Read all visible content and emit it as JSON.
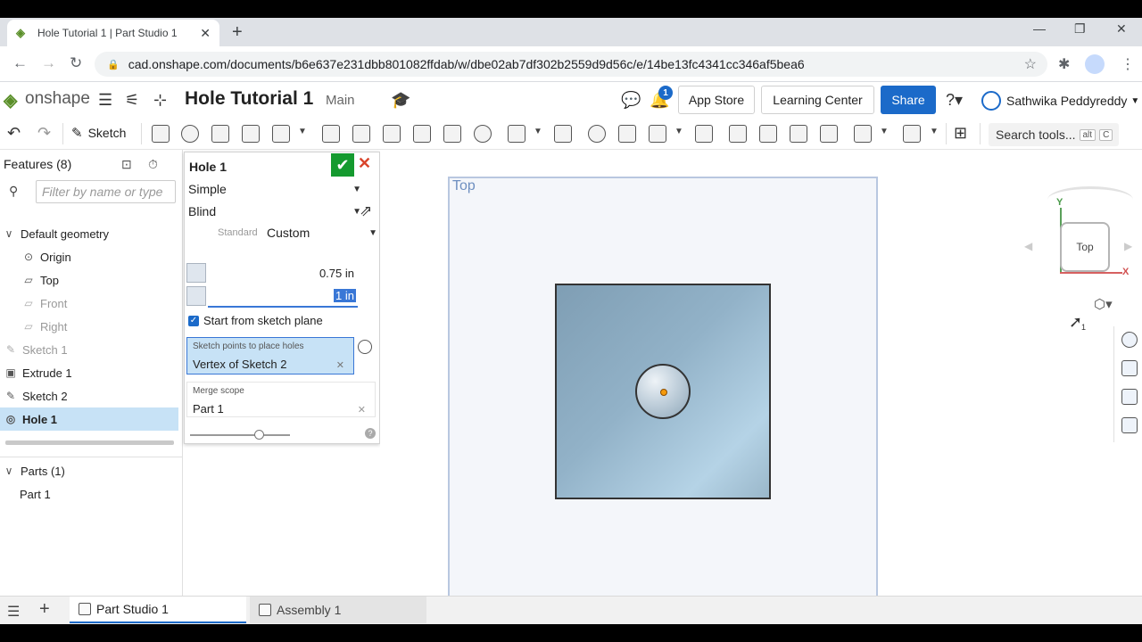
{
  "browser": {
    "tab_title": "Hole Tutorial 1 | Part Studio 1",
    "url": "cad.onshape.com/documents/b6e637e231dbb801082ffdab/w/dbe02ab7df302b2559d9d56c/e/14be13fc4341cc346af5bea6"
  },
  "header": {
    "logo_text": "onshape",
    "doc_title": "Hole Tutorial 1",
    "branch": "Main",
    "notification_count": "1",
    "app_store": "App Store",
    "learning_center": "Learning Center",
    "share": "Share",
    "user_name": "Sathwika Peddyreddy"
  },
  "toolbar": {
    "sketch_label": "Sketch",
    "search_tools": "Search tools...",
    "kbd_alt": "alt",
    "kbd_c": "C"
  },
  "features": {
    "heading": "Features (8)",
    "filter_placeholder": "Filter by name or type",
    "default_geometry": "Default geometry",
    "items": [
      {
        "label": "Origin"
      },
      {
        "label": "Top"
      },
      {
        "label": "Front"
      },
      {
        "label": "Right"
      },
      {
        "label": "Sketch 1"
      },
      {
        "label": "Extrude 1"
      },
      {
        "label": "Sketch 2"
      },
      {
        "label": "Hole 1"
      }
    ],
    "parts_heading": "Parts (1)",
    "parts": [
      {
        "label": "Part 1"
      }
    ]
  },
  "hole_dialog": {
    "title": "Hole 1",
    "hole_style": "Simple",
    "termination": "Blind",
    "standard_label": "Standard",
    "standard_value": "Custom",
    "diameter": "0.75 in",
    "depth": "1 in",
    "start_from_sketch_plane": "Start from sketch plane",
    "sketch_points_caption": "Sketch points to place holes",
    "sketch_points_value": "Vertex of Sketch 2",
    "merge_scope_caption": "Merge scope",
    "merge_scope_value": "Part 1",
    "help": "?"
  },
  "viewport": {
    "plane_label": "Top",
    "view_cube_face": "Top",
    "axis_y": "Y",
    "axis_x": "X",
    "cursor_badge": "1"
  },
  "bottom_tabs": [
    {
      "label": "Part Studio 1"
    },
    {
      "label": "Assembly 1"
    }
  ]
}
